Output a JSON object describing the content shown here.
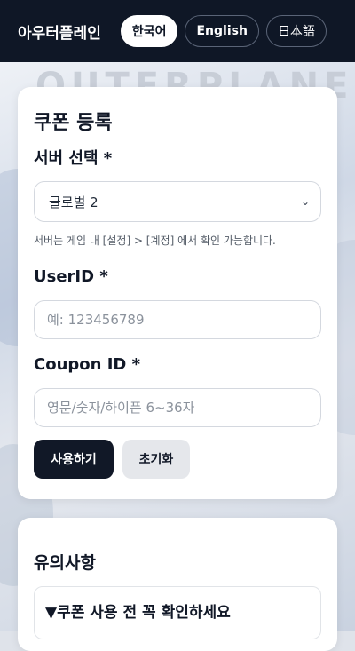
{
  "header": {
    "brand": "아우터플레인",
    "languages": [
      {
        "label": "한국어",
        "active": true
      },
      {
        "label": "English",
        "active": false
      },
      {
        "label": "日本語",
        "active": false
      }
    ]
  },
  "form": {
    "title": "쿠폰 등록",
    "server_label": "서버 선택 *",
    "server_selected": "글로벌 2",
    "server_help": "서버는 게임 내 [설정] > [계정] 에서 확인 가능합니다.",
    "userid_label": "UserID *",
    "userid_placeholder": "예: 123456789",
    "coupon_label": "Coupon ID *",
    "coupon_placeholder": "영문/숫자/하이픈 6~36자",
    "submit_label": "사용하기",
    "reset_label": "초기화"
  },
  "notes": {
    "title": "유의사항",
    "summary": "▼쿠폰 사용 전 꼭 확인하세요"
  },
  "colors": {
    "header_bg": "#0f1726",
    "primary_button": "#111827",
    "secondary_button": "#e5e7eb"
  }
}
